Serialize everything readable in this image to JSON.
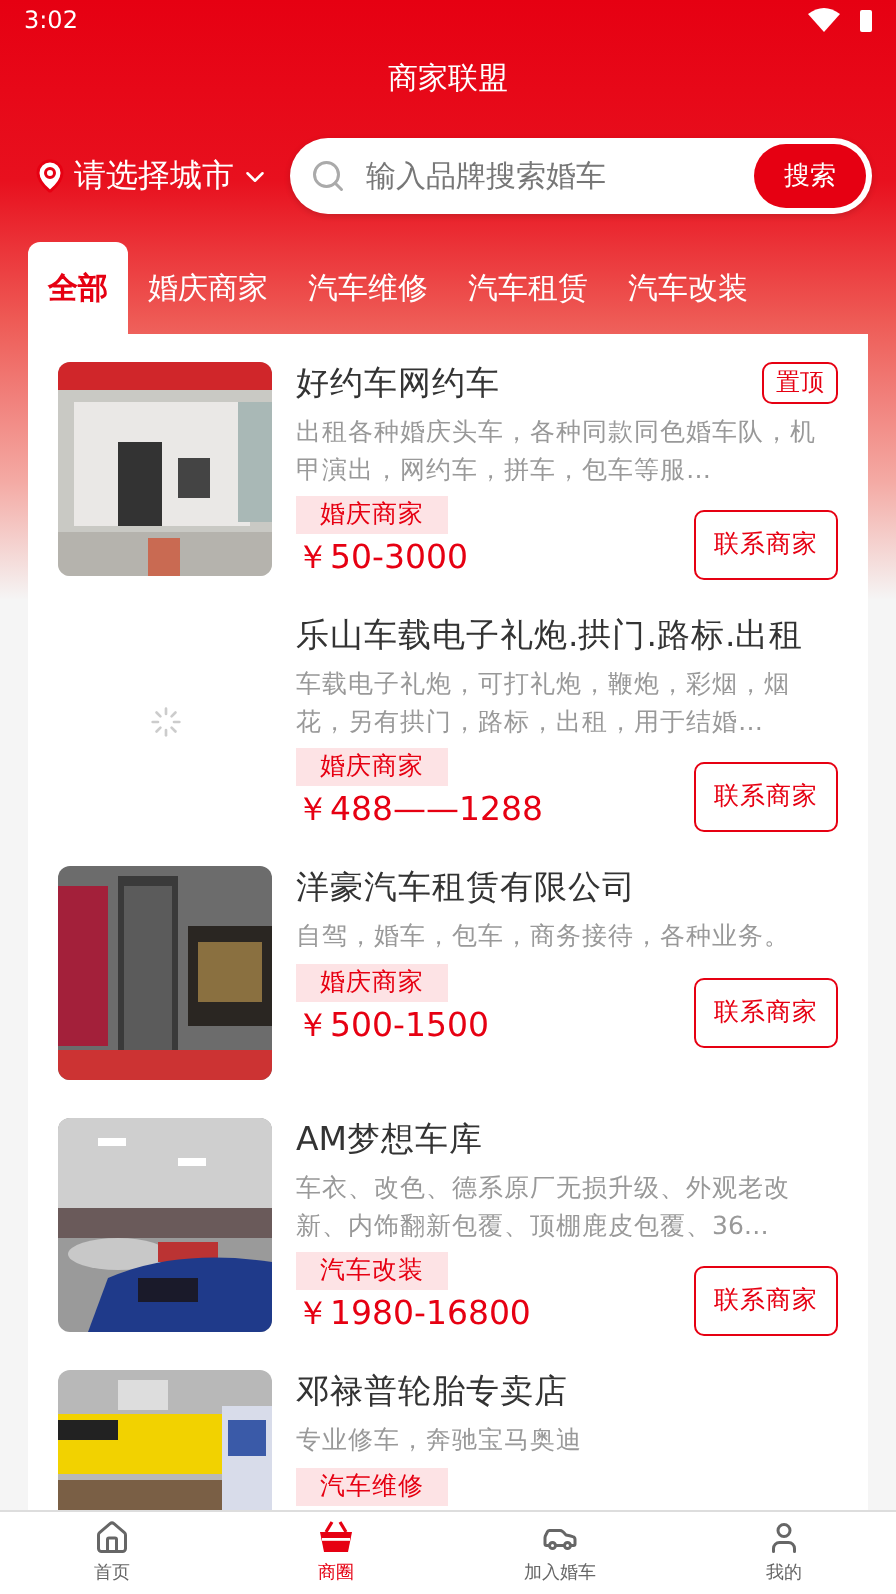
{
  "status_bar": {
    "time": "3:02"
  },
  "header": {
    "title": "商家联盟",
    "city": "请选择城市",
    "search_placeholder": "输入品牌搜索婚车",
    "search_button": "搜索"
  },
  "tabs": [
    {
      "label": "全部",
      "selected": true
    },
    {
      "label": "婚庆商家",
      "selected": false
    },
    {
      "label": "汽车维修",
      "selected": false
    },
    {
      "label": "汽车租赁",
      "selected": false
    },
    {
      "label": "汽车改装",
      "selected": false
    }
  ],
  "merchants": [
    {
      "kind": "picture",
      "name": "好约车网约车",
      "pinned": "置顶",
      "description": "出租各种婚庆头车，各种同款同色婚车队，机甲演出，网约车，拼车，包车等服…",
      "category": "婚庆商家",
      "price": "￥50-3000",
      "contact": "联系商家"
    },
    {
      "kind": "loading",
      "name": "乐山车载电子礼炮.拱门.路标.出租",
      "description": "车载电子礼炮，可打礼炮，鞭炮，彩烟，烟花，另有拱门，路标，出租，用于结婚…",
      "category": "婚庆商家",
      "price": "￥488——1288",
      "contact": "联系商家"
    },
    {
      "kind": "picture",
      "name": "洋豪汽车租赁有限公司",
      "description": "自驾，婚车，包车，商务接待，各种业务。",
      "category": "婚庆商家",
      "price": "￥500-1500",
      "contact": "联系商家"
    },
    {
      "kind": "picture",
      "name": "AM梦想车库",
      "description": "车衣、改色、德系原厂无损升级、外观老改新、内饰翻新包覆、顶棚鹿皮包覆、36…",
      "category": "汽车改装",
      "price": "￥1980-16800",
      "contact": "联系商家"
    },
    {
      "kind": "picture",
      "name": "邓禄普轮胎专卖店",
      "description": "专业修车，奔驰宝马奥迪",
      "category": "汽车维修"
    }
  ],
  "bottom_nav": [
    {
      "label": "首页",
      "selected": false
    },
    {
      "label": "商圈",
      "selected": true
    },
    {
      "label": "加入婚车",
      "selected": false
    },
    {
      "label": "我的",
      "selected": false
    }
  ]
}
